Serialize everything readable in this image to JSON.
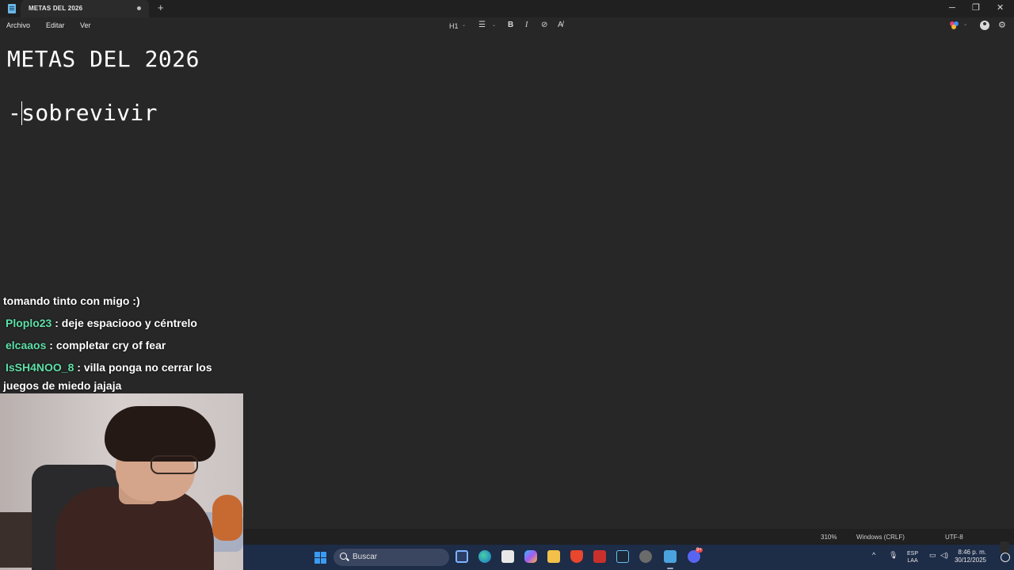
{
  "window": {
    "tab_title": "METAS DEL 2026",
    "new_tab": "+",
    "minimize": "─",
    "maximize": "❐",
    "close": "✕"
  },
  "menu": {
    "items": [
      "Archivo",
      "Editar",
      "Ver"
    ]
  },
  "format_toolbar": {
    "heading": "H1",
    "chevron": "⌄",
    "list": "☰",
    "bold": "B",
    "italic": "I",
    "link": "⊘",
    "clear": "A̸"
  },
  "document": {
    "heading": "METAS DEL 2026",
    "line_prefix": "-",
    "line_text": "sobrevivir"
  },
  "chat": {
    "intro": "tomando tinto con migo :)",
    "messages": [
      {
        "user": "Ploplo23",
        "text": " : deje espaciooo y céntrelo"
      },
      {
        "user": "elcaaos",
        "text": " : completar cry of fear"
      },
      {
        "user": "IsSH4NOO_8",
        "text": " : villa ponga no cerrar los juegos de miedo jajaja"
      }
    ]
  },
  "status": {
    "zoom": "310%",
    "line_ending": "Windows (CRLF)",
    "encoding": "UTF-8"
  },
  "taskbar": {
    "search_placeholder": "Buscar",
    "lang_top": "ESP",
    "lang_bottom": "LAA",
    "time": "8:46 p. m.",
    "date": "30/12/2025",
    "tray_up": "^",
    "chat_badge": "9+"
  },
  "colors": {
    "editor_bg": "#272727",
    "chat_username": "#5ee0a8",
    "taskbar_bg": "#1d2c47"
  }
}
